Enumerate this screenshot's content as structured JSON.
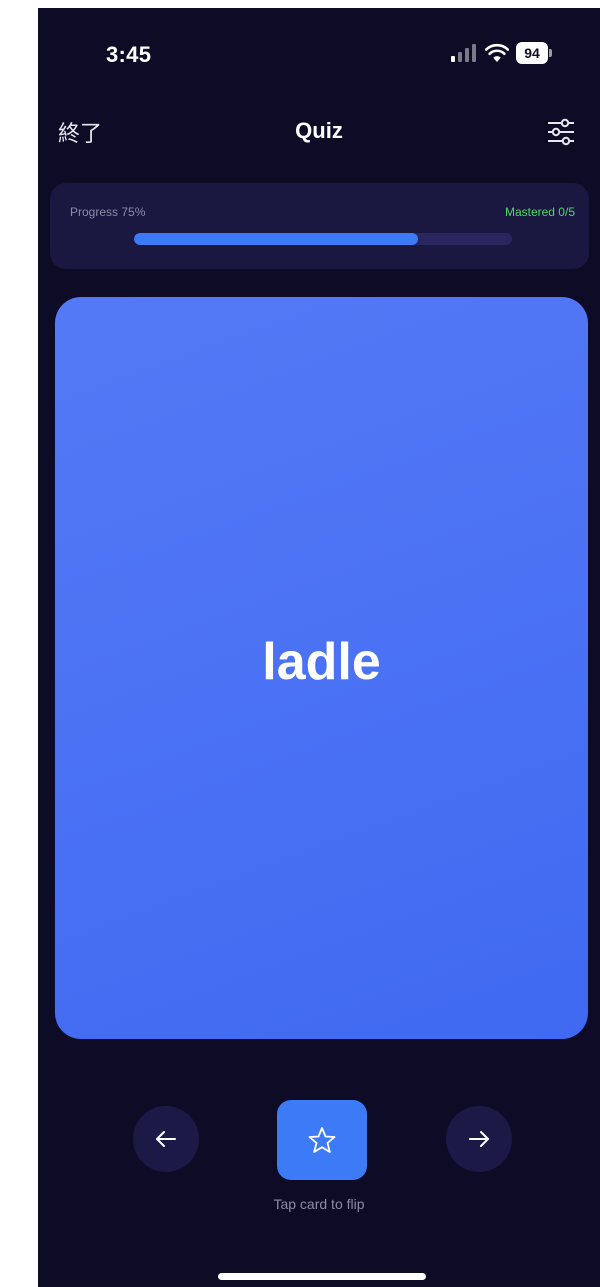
{
  "status_bar": {
    "time": "3:45",
    "battery": "94",
    "icons": [
      "signal-icon",
      "wifi-icon",
      "battery-icon"
    ]
  },
  "nav": {
    "end_label": "終了",
    "title": "Quiz",
    "settings_icon": "sliders-icon"
  },
  "progress": {
    "label": "Progress 75%",
    "value": 0.75,
    "mastered_label": "Mastered 0/5"
  },
  "card": {
    "word": "ladle"
  },
  "controls": {
    "prev_icon": "arrow-left-icon",
    "star_icon": "star-icon",
    "next_icon": "arrow-right-icon",
    "hint": "Tap card to flip"
  },
  "colors": {
    "background": "#0e0b26",
    "panel": "#1a1740",
    "accent": "#3d7af5",
    "card": "#4b72f4",
    "mastered": "#4cd964",
    "muted_text": "#8d8ca8"
  }
}
